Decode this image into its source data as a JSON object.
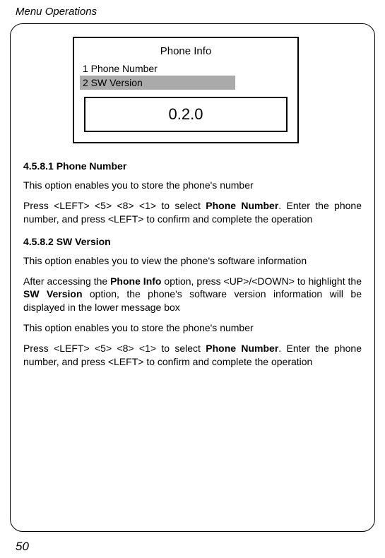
{
  "header": "Menu Operations",
  "phone_screen": {
    "title": "Phone Info",
    "item1": "1 Phone Number",
    "item2": "2 SW Version",
    "version": "0.2.0"
  },
  "section1": {
    "heading": "4.5.8.1 Phone Number",
    "p1": "This option enables you to store the phone's number",
    "p2a": "Press <LEFT> <5> <8> <1> to select ",
    "p2b": "Phone Number",
    "p2c": ". Enter the phone number, and press <LEFT> to confirm and complete the operation"
  },
  "section2": {
    "heading": "4.5.8.2 SW Version",
    "p1": "This option enables you to view the phone's software information",
    "p2a": "After accessing the ",
    "p2b": "Phone Info",
    "p2c": " option, press <UP>/<DOWN> to highlight the ",
    "p2d": "SW Version",
    "p2e": " option, the phone's software version information will be displayed in the lower message box",
    "p3": "This option enables you to store the phone's number",
    "p4a": "Press <LEFT> <5> <8> <1> to select ",
    "p4b": "Phone Number",
    "p4c": ". Enter the phone number, and press <LEFT> to confirm and complete the operation"
  },
  "page_number": "50"
}
